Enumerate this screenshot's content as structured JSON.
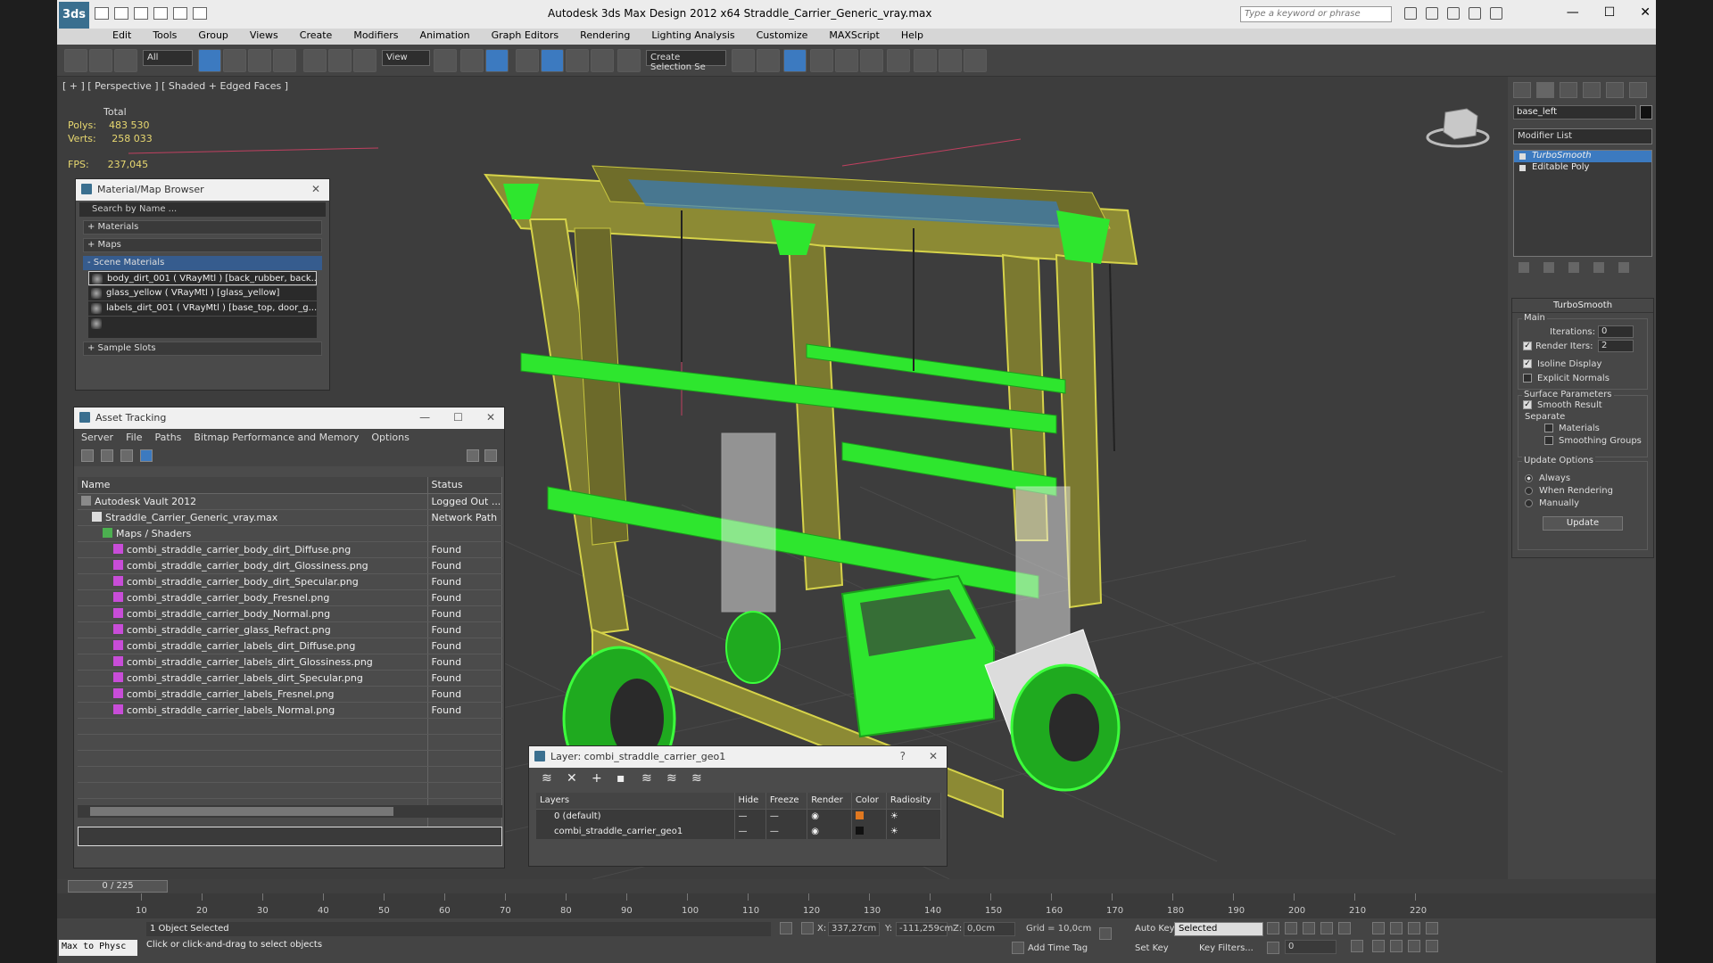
{
  "window": {
    "title": "Autodesk 3ds Max Design 2012 x64      Straddle_Carrier_Generic_vray.max",
    "search_placeholder": "Type a keyword or phrase",
    "logo": "3ds",
    "minimize": "—",
    "maximize": "☐",
    "close": "✕"
  },
  "menu": [
    "Edit",
    "Tools",
    "Group",
    "Views",
    "Create",
    "Modifiers",
    "Animation",
    "Graph Editors",
    "Rendering",
    "Lighting Analysis",
    "Customize",
    "MAXScript",
    "Help"
  ],
  "toolbar": {
    "filter_select": "All",
    "view_select": "View",
    "selection_set": "Create Selection Se"
  },
  "viewport": {
    "label": "[ + ] [ Perspective ] [ Shaded + Edged Faces ]",
    "stats_header": "Total",
    "polys_label": "Polys:",
    "polys_value": "483 530",
    "verts_label": "Verts:",
    "verts_value": "258 033",
    "fps_label": "FPS:",
    "fps_value": "237,045"
  },
  "material_browser": {
    "title": "Material/Map Browser",
    "search_placeholder": "Search by Name ...",
    "groups": {
      "materials": "+ Materials",
      "maps": "+ Maps",
      "scene": "- Scene Materials",
      "sample": "+ Sample Slots"
    },
    "scene_materials": [
      "body_dirt_001  ( VRayMtl )  [back_rubber, back...",
      "glass_yellow  ( VRayMtl )  [glass_yellow]",
      "labels_dirt_001  ( VRayMtl )  [base_top, door_g..."
    ]
  },
  "asset_tracking": {
    "title": "Asset Tracking",
    "menu": [
      "Server",
      "File",
      "Paths",
      "Bitmap Performance and Memory",
      "Options"
    ],
    "columns": {
      "name": "Name",
      "status": "Status"
    },
    "rows": [
      {
        "name": "Autodesk Vault 2012",
        "status": "Logged Out ...",
        "indent": 1
      },
      {
        "name": "Straddle_Carrier_Generic_vray.max",
        "status": "Network Path",
        "indent": 2
      },
      {
        "name": "Maps / Shaders",
        "status": "",
        "indent": 3
      },
      {
        "name": "combi_straddle_carrier_body_dirt_Diffuse.png",
        "status": "Found",
        "indent": 4
      },
      {
        "name": "combi_straddle_carrier_body_dirt_Glossiness.png",
        "status": "Found",
        "indent": 4
      },
      {
        "name": "combi_straddle_carrier_body_dirt_Specular.png",
        "status": "Found",
        "indent": 4
      },
      {
        "name": "combi_straddle_carrier_body_Fresnel.png",
        "status": "Found",
        "indent": 4
      },
      {
        "name": "combi_straddle_carrier_body_Normal.png",
        "status": "Found",
        "indent": 4
      },
      {
        "name": "combi_straddle_carrier_glass_Refract.png",
        "status": "Found",
        "indent": 4
      },
      {
        "name": "combi_straddle_carrier_labels_dirt_Diffuse.png",
        "status": "Found",
        "indent": 4
      },
      {
        "name": "combi_straddle_carrier_labels_dirt_Glossiness.png",
        "status": "Found",
        "indent": 4
      },
      {
        "name": "combi_straddle_carrier_labels_dirt_Specular.png",
        "status": "Found",
        "indent": 4
      },
      {
        "name": "combi_straddle_carrier_labels_Fresnel.png",
        "status": "Found",
        "indent": 4
      },
      {
        "name": "combi_straddle_carrier_labels_Normal.png",
        "status": "Found",
        "indent": 4
      }
    ]
  },
  "layer_panel": {
    "title": "Layer: combi_straddle_carrier_geo1",
    "help": "?",
    "columns": [
      "Layers",
      "Hide",
      "Freeze",
      "Render",
      "Color",
      "Radiosity"
    ],
    "rows": [
      {
        "name": "0 (default)",
        "color": "#e07820",
        "current": false
      },
      {
        "name": "combi_straddle_carrier_geo1",
        "color": "#111111",
        "current": true
      }
    ]
  },
  "command_panel": {
    "object_name": "base_left",
    "modifier_list": "Modifier List",
    "stack": [
      "TurboSmooth",
      "Editable Poly"
    ],
    "rollout_title": "TurboSmooth",
    "main_group": "Main",
    "iterations_label": "Iterations:",
    "iterations_value": "0",
    "render_iters_label": "Render Iters:",
    "render_iters_value": "2",
    "isoline_label": "Isoline Display",
    "explicit_normals_label": "Explicit Normals",
    "surface_group": "Surface Parameters",
    "smooth_result_label": "Smooth Result",
    "separate_label": "Separate",
    "materials_label": "Materials",
    "smoothing_groups_label": "Smoothing Groups",
    "update_group": "Update Options",
    "always_label": "Always",
    "when_rendering_label": "When Rendering",
    "manually_label": "Manually",
    "update_button": "Update"
  },
  "timeline": {
    "frame_display": "0 / 225",
    "ticks": [
      "10",
      "20",
      "30",
      "40",
      "50",
      "60",
      "70",
      "80",
      "90",
      "100",
      "110",
      "120",
      "130",
      "140",
      "150",
      "160",
      "170",
      "180",
      "190",
      "200",
      "210",
      "220"
    ]
  },
  "status": {
    "maxscript": "Max to Physc",
    "selected": "1 Object Selected",
    "prompt": "Click or click-and-drag to select objects",
    "x_label": "X:",
    "x_value": "337,27cm",
    "y_label": "Y:",
    "y_value": "-111,259cm",
    "z_label": "Z:",
    "z_value": "0,0cm",
    "grid": "Grid = 10,0cm",
    "auto_key": "Auto Key",
    "set_key": "Set Key",
    "selected_drop": "Selected",
    "key_filters": "Key Filters...",
    "add_time_tag": "Add Time Tag",
    "frame": "0"
  }
}
